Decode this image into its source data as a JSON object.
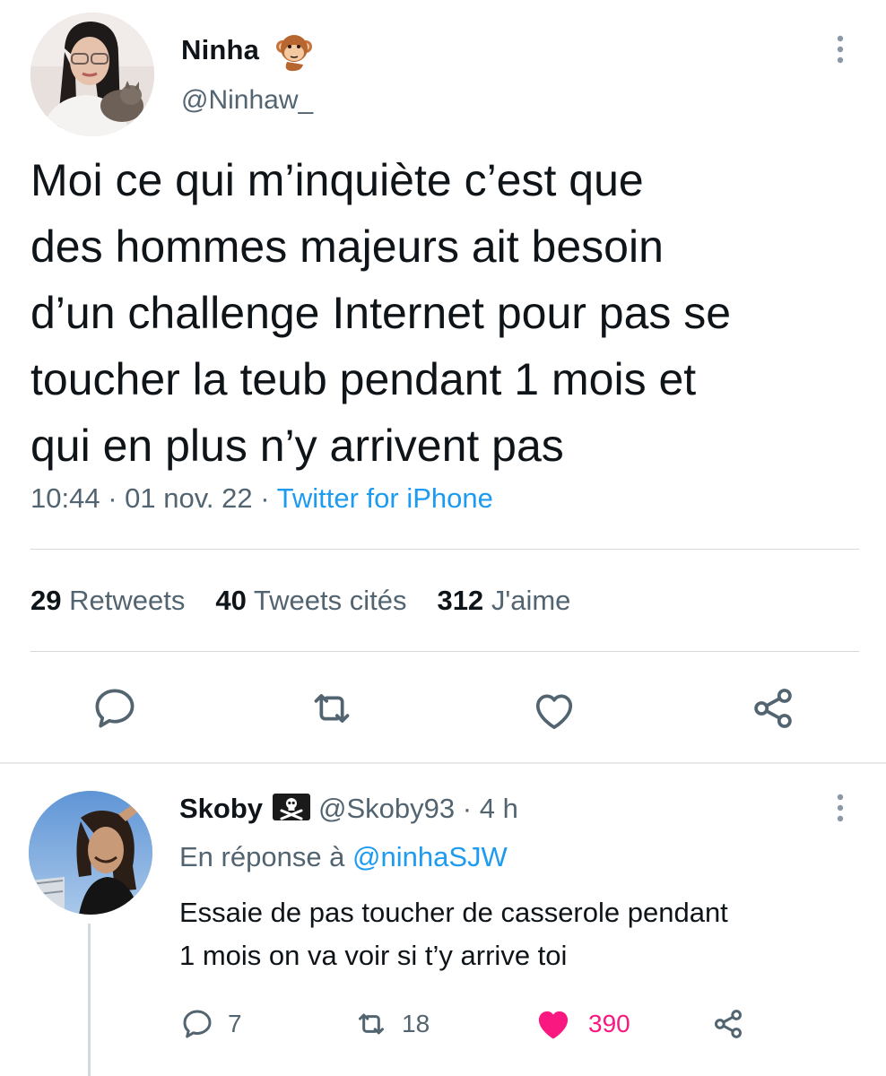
{
  "tweet": {
    "author_name": "Ninha",
    "author_emoji": "monkey-emoji",
    "author_handle": "@Ninhaw_",
    "text": "Moi ce qui m’inquiète c’est que\ndes hommes majeurs ait besoin\nd’un challenge Internet pour pas se\ntoucher la teub pendant 1 mois et\nqui en plus n’y arrivent pas",
    "time": "10:44",
    "date": "01 nov. 22",
    "source": "Twitter for iPhone",
    "separator": "·",
    "stats": {
      "retweets_count": "29",
      "retweets_label": "Retweets",
      "quotes_count": "40",
      "quotes_label": "Tweets cités",
      "likes_count": "312",
      "likes_label": "J'aime"
    },
    "actions": [
      "reply-icon",
      "retweet-icon",
      "like-icon",
      "share-icon"
    ]
  },
  "reply": {
    "author_name": "Skoby",
    "author_badge": "pirate-flag-emoji",
    "author_handle": "@Skoby93",
    "age": "4 h",
    "separator": "·",
    "replying_to_label": "En réponse à",
    "replying_to_handle": "@ninhaSJW",
    "text": "Essaie de pas toucher de casserole pendant\n1 mois on va voir si t’y arrive toi",
    "replies": "7",
    "retweets": "18",
    "likes": "390",
    "liked": true
  },
  "colors": {
    "text": "#0f1419",
    "secondary": "#536471",
    "link": "#1d9bf0",
    "like": "#f91880",
    "divider": "#d7dadd"
  }
}
